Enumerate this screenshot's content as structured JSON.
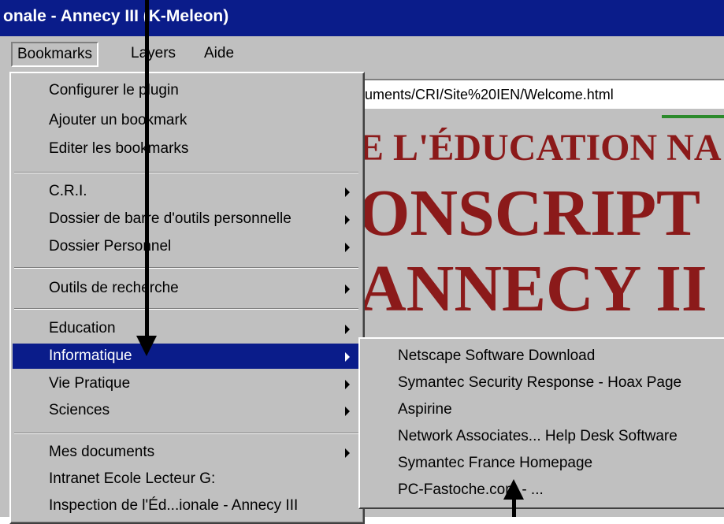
{
  "window": {
    "title": "onale - Annecy III (K-Meleon)"
  },
  "menubar": {
    "items": [
      "Bookmarks",
      "Layers",
      "Aide"
    ]
  },
  "address_bar": {
    "value": "uments/CRI/Site%20IEN/Welcome.html"
  },
  "page_heading": {
    "line1": "E L'ÉDUCATION NA",
    "line2": "ONSCRIPT",
    "line3": "ANNECY II"
  },
  "bookmarks_menu": {
    "configure": "Configurer le plugin",
    "add": "Ajouter un bookmark",
    "edit": "Editer les bookmarks",
    "folders1": [
      "C.R.I.",
      "Dossier de barre d'outils personnelle",
      "Dossier Personnel"
    ],
    "search": "Outils de recherche",
    "folders2": [
      "Education",
      "Informatique",
      "Vie Pratique",
      "Sciences"
    ],
    "mes_documents": "Mes documents",
    "intranet": "Intranet Ecole Lecteur G:",
    "inspection": "Inspection de l'Éd...ionale - Annecy III"
  },
  "informatique_submenu": {
    "items": [
      "Netscape Software Download",
      "Symantec Security Response - Hoax Page",
      "Aspirine",
      "Network Associates... Help Desk Software",
      "Symantec France Homepage",
      "PC-Fastoche.com - ..."
    ]
  },
  "colors": {
    "titlebar": "#0a1c8a",
    "highlight": "#0a1c8a",
    "heading": "#8b1a1a",
    "chrome": "#c0c0c0"
  }
}
